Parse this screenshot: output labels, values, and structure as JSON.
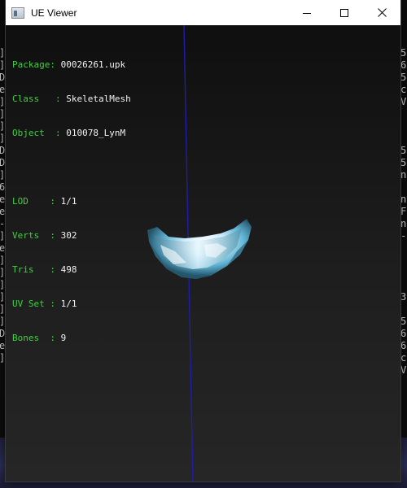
{
  "window": {
    "title": "UE Viewer"
  },
  "mesh_info": {
    "package_label": "Package",
    "package": "00026261.upk",
    "class_label": "Class",
    "class": "SkeletalMesh",
    "object_label": "Object",
    "object": "010078_LynM",
    "lod_label": "LOD",
    "lod": "1/1",
    "verts_label": "Verts",
    "verts": "302",
    "tris_label": "Tris",
    "tris": "498",
    "uvset_label": "UV Set",
    "uvset": "1/1",
    "bones_label": "Bones",
    "bones": "9"
  },
  "background_console": {
    "left_column": [
      "]",
      "]",
      "D",
      "e",
      "]",
      "]",
      "]",
      "]",
      "D",
      "D",
      "]",
      "6",
      "e",
      "e",
      "-",
      "]",
      "e",
      "]",
      "]",
      "]",
      "]",
      "]",
      "]",
      "D",
      "e",
      "]"
    ],
    "right_column": [
      "5",
      "6",
      "5",
      "c",
      "V",
      "",
      "",
      "",
      "5",
      "5",
      "n",
      "",
      "n",
      "F",
      "n",
      "-",
      "",
      "",
      "",
      "",
      "3",
      "",
      "5",
      "6",
      "6",
      "c",
      "V"
    ]
  },
  "colors": {
    "info_label": "#3fd23f",
    "info_value": "#f2f2f2",
    "axis": "#1e1ea8",
    "viewport_bg": "#232323"
  }
}
